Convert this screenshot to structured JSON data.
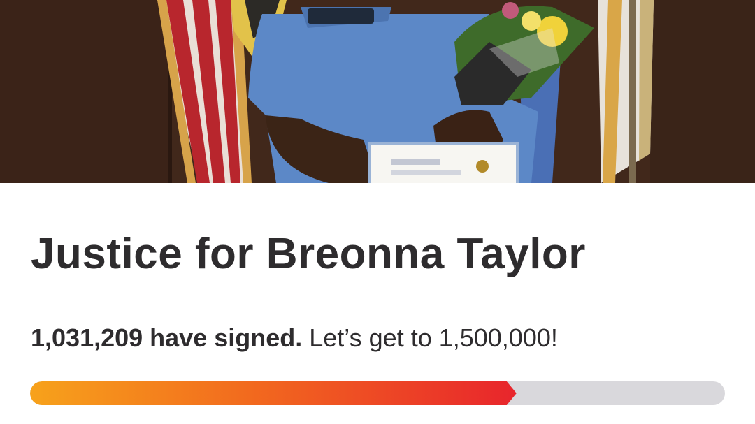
{
  "hero": {
    "image_alt": "Woman in blue uniform holding a certificate and flowers in front of flags"
  },
  "petition": {
    "title": "Justice for Breonna Taylor",
    "signed_count_text": "1,031,209 have signed.",
    "goal_text": "Let’s get to 1,500,000!",
    "signed": 1031209,
    "goal": 1500000,
    "progress_fraction": 0.7
  },
  "colors": {
    "title_text": "#2e2c2e",
    "progress_start": "#f7a21b",
    "progress_end": "#e8252c",
    "progress_track": "#d9d8dc"
  }
}
